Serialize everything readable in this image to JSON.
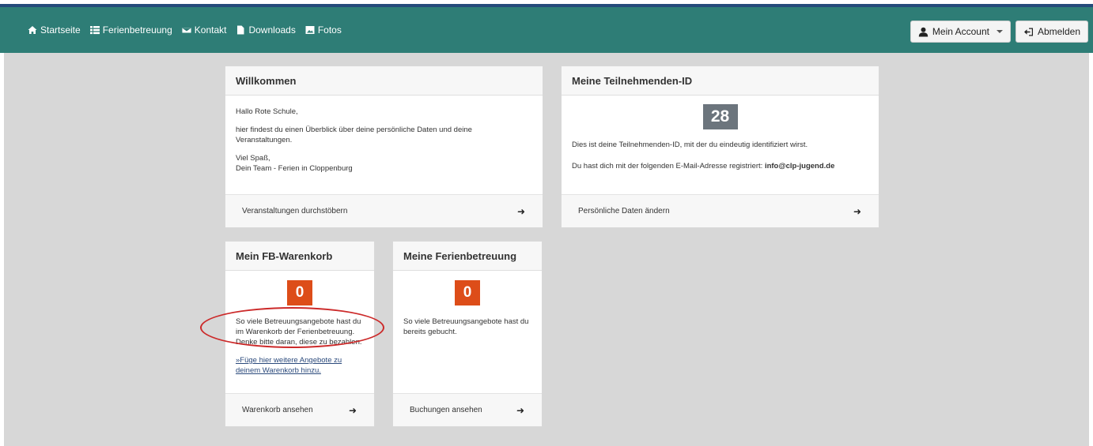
{
  "nav": {
    "items": [
      {
        "label": "Startseite",
        "icon": "home-icon"
      },
      {
        "label": "Ferienbetreuung",
        "icon": "list-icon"
      },
      {
        "label": "Kontakt",
        "icon": "envelope-icon"
      },
      {
        "label": "Downloads",
        "icon": "file-icon"
      },
      {
        "label": "Fotos",
        "icon": "image-icon"
      }
    ],
    "account_label": "Mein Account",
    "logout_label": "Abmelden"
  },
  "welcome": {
    "title": "Willkommen",
    "greeting": "Hallo Rote Schule,",
    "intro": "hier findest du einen Überblick über deine persönliche Daten und deine Veranstaltungen.",
    "sign1": "Viel Spaß,",
    "sign2": "Dein Team - Ferien in Cloppenburg",
    "footer": "Veranstaltungen durchstöbern"
  },
  "participant": {
    "title": "Meine Teilnehmenden-ID",
    "id": "28",
    "text": "Dies ist deine Teilnehmenden-ID, mit der du eindeutig identifiziert wirst.",
    "email_prefix": "Du hast dich mit der folgenden E-Mail-Adresse registriert: ",
    "email": "info@clp-jugend.de",
    "footer": "Persönliche Daten ändern"
  },
  "cart": {
    "title": "Mein FB-Warenkorb",
    "count": "0",
    "text": "So viele Betreuungsangebote hast du im Warenkorb der Ferienbetreuung. Denke bitte daran, diese zu bezahlen.",
    "link": "»Füge hier weitere Angebote zu deinem Warenkorb hinzu.",
    "footer": "Warenkorb ansehen"
  },
  "booking": {
    "title": "Meine Ferienbetreuung",
    "count": "0",
    "text": "So viele Betreuungsangebote hast du bereits gebucht.",
    "footer": "Buchungen ansehen"
  },
  "colors": {
    "navbar": "#2e7d76",
    "badge_red": "#dd4d19",
    "badge_grey": "#6c757d",
    "annotation": "#cc2a2a"
  }
}
